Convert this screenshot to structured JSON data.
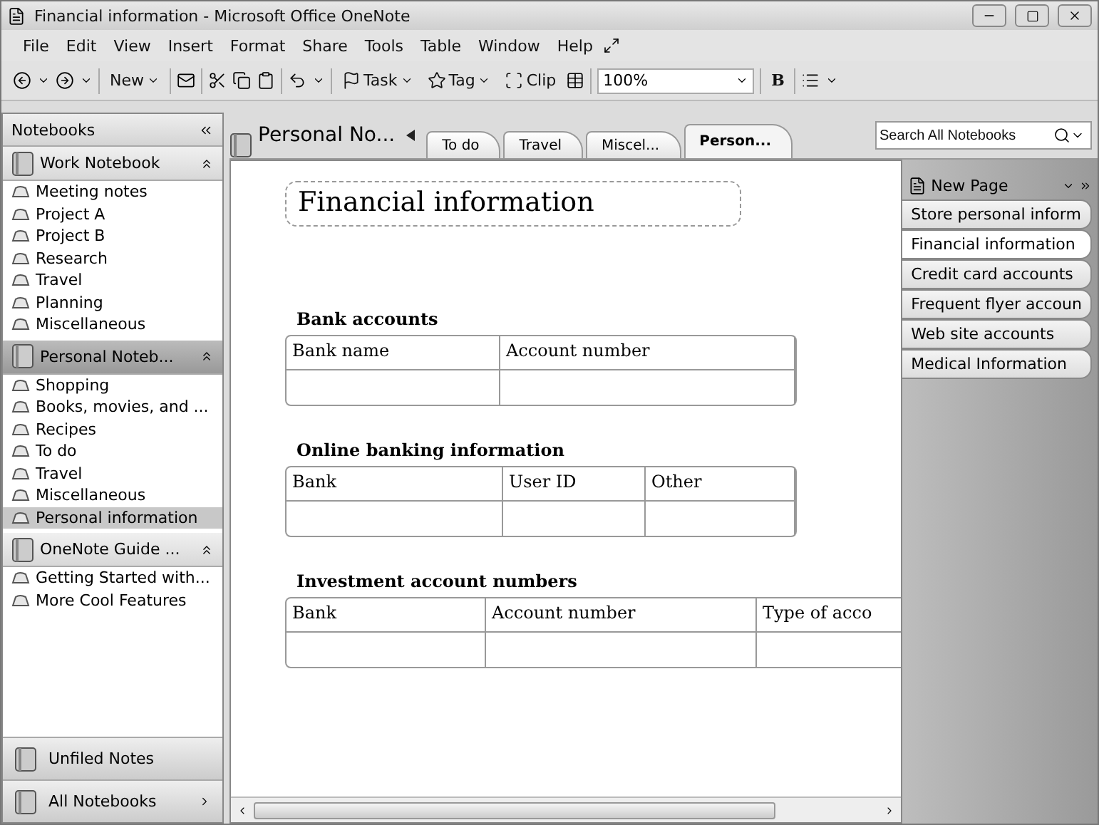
{
  "window": {
    "title": "Financial information - Microsoft Office OneNote"
  },
  "menu": [
    "File",
    "Edit",
    "View",
    "Insert",
    "Format",
    "Share",
    "Tools",
    "Table",
    "Window",
    "Help"
  ],
  "toolbar": {
    "new_label": "New",
    "task_label": "Task",
    "tag_label": "Tag",
    "clip_label": "Clip",
    "zoom": "100%",
    "bold_label": "B"
  },
  "sidebar": {
    "title": "Notebooks",
    "notebooks": [
      {
        "name": "Work Notebook",
        "expanded": true,
        "selected": false,
        "sections": [
          {
            "name": "Meeting notes",
            "selected": false
          },
          {
            "name": "Project A",
            "selected": false
          },
          {
            "name": "Project B",
            "selected": false
          },
          {
            "name": "Research",
            "selected": false
          },
          {
            "name": "Travel",
            "selected": false
          },
          {
            "name": "Planning",
            "selected": false
          },
          {
            "name": "Miscellaneous",
            "selected": false
          }
        ]
      },
      {
        "name": "Personal Noteb...",
        "expanded": true,
        "selected": true,
        "sections": [
          {
            "name": "Shopping",
            "selected": false
          },
          {
            "name": "Books, movies, and ...",
            "selected": false
          },
          {
            "name": "Recipes",
            "selected": false
          },
          {
            "name": "To do",
            "selected": false
          },
          {
            "name": "Travel",
            "selected": false
          },
          {
            "name": "Miscellaneous",
            "selected": false
          },
          {
            "name": "Personal information",
            "selected": true
          }
        ]
      },
      {
        "name": "OneNote Guide ...",
        "expanded": true,
        "selected": false,
        "sections": [
          {
            "name": "Getting Started with...",
            "selected": false
          },
          {
            "name": "More Cool Features",
            "selected": false
          }
        ]
      }
    ],
    "unfiled": "Unfiled Notes",
    "all_notebooks": "All Notebooks"
  },
  "notebook_title": "Personal No...",
  "section_tabs": [
    {
      "label": "To do",
      "selected": false
    },
    {
      "label": "Travel",
      "selected": false
    },
    {
      "label": "Miscel...",
      "selected": false
    },
    {
      "label": "Person...",
      "selected": true
    }
  ],
  "search": {
    "placeholder": "Search All Notebooks"
  },
  "page": {
    "title": "Financial information",
    "tables": [
      {
        "heading": "Bank accounts",
        "columns": [
          "Bank name",
          "Account number"
        ]
      },
      {
        "heading": "Online banking information",
        "columns": [
          "Bank",
          "User ID",
          "Other"
        ]
      },
      {
        "heading": "Investment account numbers",
        "columns": [
          "Bank",
          "Account number",
          "Type of acco"
        ]
      }
    ]
  },
  "new_page": "New Page",
  "pages": [
    {
      "title": "Store personal inform",
      "selected": false
    },
    {
      "title": "Financial information",
      "selected": true
    },
    {
      "title": "Credit card accounts",
      "selected": false
    },
    {
      "title": "Frequent flyer accoun",
      "selected": false
    },
    {
      "title": "Web site accounts",
      "selected": false
    },
    {
      "title": "Medical Information",
      "selected": false
    }
  ]
}
